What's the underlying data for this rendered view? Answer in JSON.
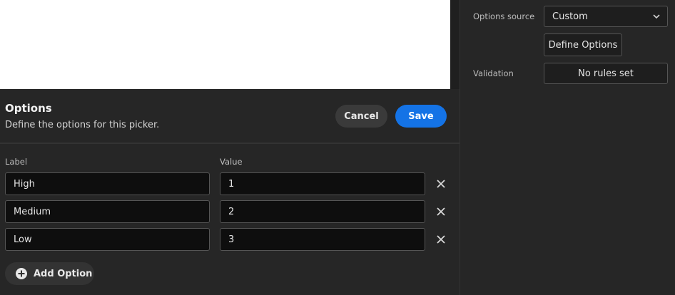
{
  "properties": {
    "options_source_label": "Options source",
    "options_source_value": "Custom",
    "define_options_label": "Define Options",
    "validation_label": "Validation",
    "validation_value": "No rules set"
  },
  "dialog": {
    "title": "Options",
    "subtitle": "Define the options for this picker.",
    "cancel_label": "Cancel",
    "save_label": "Save",
    "label_header": "Label",
    "value_header": "Value",
    "rows": [
      {
        "label": "High",
        "value": "1"
      },
      {
        "label": "Medium",
        "value": "2"
      },
      {
        "label": "Low",
        "value": "3"
      }
    ],
    "add_option_label": "Add Option"
  },
  "colors": {
    "accent": "#1473e6",
    "panel": "#262626",
    "field_bg": "#0e0e0e"
  }
}
